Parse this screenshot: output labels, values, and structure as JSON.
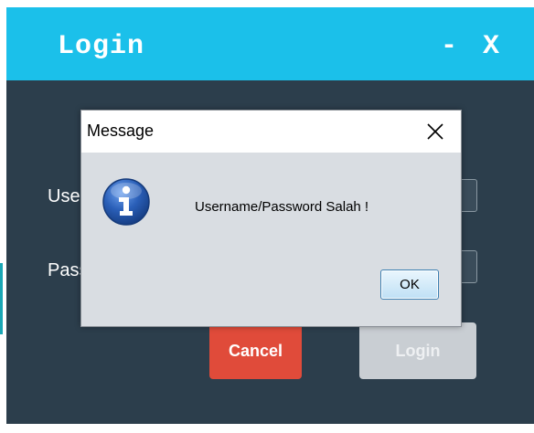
{
  "login_window": {
    "title": "Login",
    "minimize_label": "-",
    "close_label": "X",
    "username_label": "Username",
    "password_label": "Password",
    "username_value": "",
    "password_value": "",
    "cancel_label": "Cancel",
    "login_label": "Login"
  },
  "dialog": {
    "title": "Message",
    "message": "Username/Password Salah !",
    "ok_label": "OK",
    "icon": "information-icon",
    "close_icon": "close-icon"
  },
  "colors": {
    "titlebar": "#1bc0ea",
    "window_bg": "#2c3e4c",
    "cancel_button": "#e04b3a",
    "login_button": "#c9ced3",
    "dialog_bg": "#d9dde2",
    "info_icon": "#2a5fb8"
  }
}
